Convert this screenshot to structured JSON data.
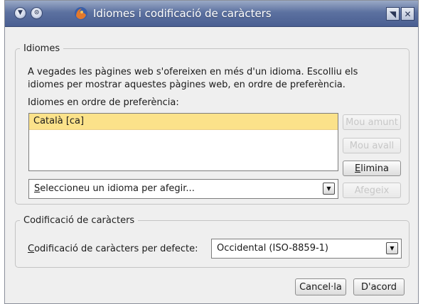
{
  "window": {
    "title": "Idiomes i codificació de caràcters",
    "menu_glyph": "▼",
    "pin_glyph": "⊙",
    "maximize_glyph": "◥",
    "close_glyph": "✕"
  },
  "languages": {
    "group_label": "Idiomes",
    "description_line1": "A vegades les pàgines web s'ofereixen en més d'un idioma. Escolliu els",
    "description_line2": "idiomes per mostrar aquestes pàgines web, en ordre de preferència.",
    "list_label": "Idiomes en ordre de preferència:",
    "items": [
      {
        "label": "Català  [ca]",
        "selected": true
      }
    ],
    "move_up_button": "Mou amunt",
    "move_down_button": "Mou avall",
    "remove_button_rest": "limina",
    "remove_button_mnemonic": "E",
    "select_mnemonic": "S",
    "select_placeholder_rest": "eleccioneu un idioma per afegir...",
    "add_button": "Afegeix",
    "combo_arrow_glyph": "▼"
  },
  "encoding": {
    "group_label": "Codificació de caràcters",
    "default_label_mnemonic": "C",
    "default_label_rest": "odificació de caràcters per defecte:",
    "selected_value": "Occidental (ISO-8859-1)",
    "combo_arrow_glyph": "▼"
  },
  "footer": {
    "cancel_button": "Cancel·la",
    "ok_button": "D'acord"
  },
  "colors": {
    "titlebar": "#5c71a0",
    "selection": "#fbe28a",
    "disabled_text": "#c7c7c7"
  }
}
